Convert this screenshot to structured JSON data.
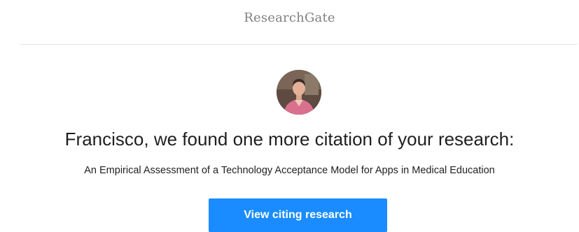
{
  "header": {
    "brand": "ResearchGate"
  },
  "notification": {
    "headline": "Francisco, we found one more citation of your research:",
    "publication_title": "An Empirical Assessment of a Technology Acceptance Model for Apps in Medical Education",
    "cta_label": "View citing research"
  },
  "colors": {
    "button_bg": "#1a8cff",
    "brand_text": "#808080",
    "divider": "#e6e6e6"
  }
}
